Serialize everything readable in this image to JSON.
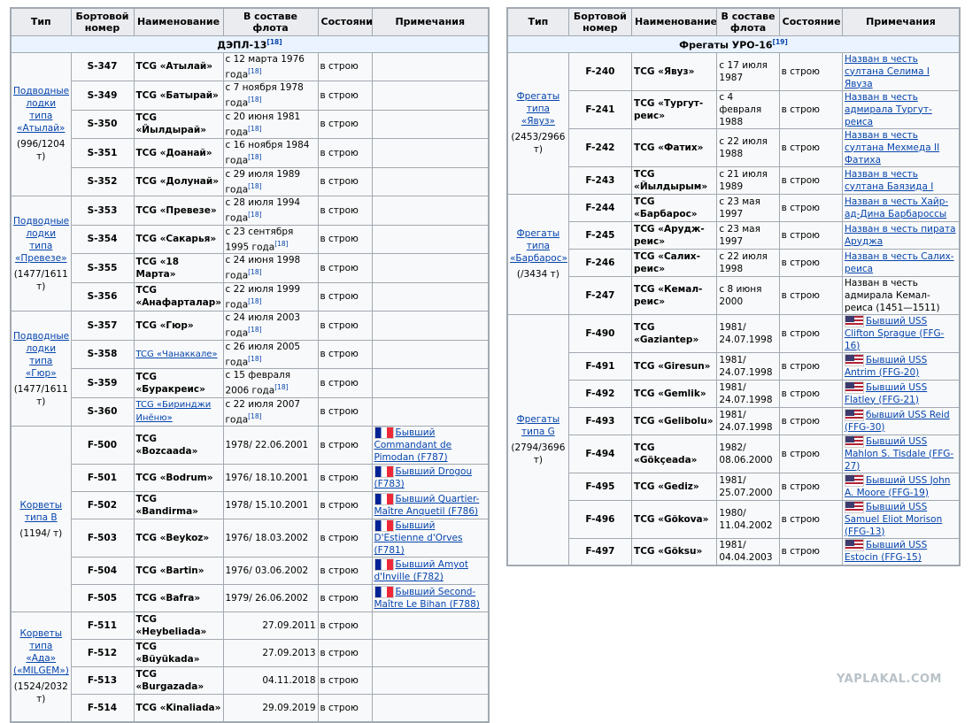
{
  "headers": [
    "Тип",
    "Бортовой номер",
    "Наименование",
    "В составе флота",
    "Состояние",
    "Примечания"
  ],
  "left": {
    "section": "ДЭПЛ-13",
    "section_ref": "[18]",
    "groups": [
      {
        "type_link": "Подводные лодки типа «Атылай»",
        "type_disp": "(996/1204 т)",
        "rows": [
          {
            "num": "S-347",
            "name": "TCG «Атылай»",
            "fleet": "с 12 марта 1976 года",
            "ref": "[18]",
            "state": "в строю",
            "note": ""
          },
          {
            "num": "S-349",
            "name": "TCG «Батырай»",
            "fleet": "с 7 ноября 1978 года",
            "ref": "[18]",
            "state": "в строю",
            "note": ""
          },
          {
            "num": "S-350",
            "name": "TCG «Йылдырай»",
            "fleet": "с 20 июня 1981 года",
            "ref": "[18]",
            "state": "в строю",
            "note": ""
          },
          {
            "num": "S-351",
            "name": "TCG «Доанай»",
            "fleet": "с 16 ноября 1984 года",
            "ref": "[18]",
            "state": "в строю",
            "note": ""
          },
          {
            "num": "S-352",
            "name": "TCG «Долунай»",
            "fleet": "с 29 июля 1989 года",
            "ref": "[18]",
            "state": "в строю",
            "note": ""
          }
        ]
      },
      {
        "type_link": "Подводные лодки типа «Превезе»",
        "type_disp": "(1477/1611 т)",
        "rows": [
          {
            "num": "S-353",
            "name": "TCG «Превезе»",
            "fleet": "с 28 июля 1994 года",
            "ref": "[18]",
            "state": "в строю",
            "note": ""
          },
          {
            "num": "S-354",
            "name": "TCG «Сакарья»",
            "fleet": "с 23 сентября 1995 года",
            "ref": "[18]",
            "state": "в строю",
            "note": ""
          },
          {
            "num": "S-355",
            "name": "TCG «18 Марта»",
            "fleet": "с 24 июня 1998 года",
            "ref": "[18]",
            "state": "в строю",
            "note": ""
          },
          {
            "num": "S-356",
            "name": "TCG «Анафарталар»",
            "fleet": "с 22 июля 1999 года",
            "ref": "[18]",
            "state": "в строю",
            "note": ""
          }
        ]
      },
      {
        "type_link": "Подводные лодки типа «Гюр»",
        "type_disp": "(1477/1611 т)",
        "rows": [
          {
            "num": "S-357",
            "name": "TCG «Гюр»",
            "fleet": "с 24 июля 2003 года",
            "ref": "[18]",
            "state": "в строю",
            "note": ""
          },
          {
            "num": "S-358",
            "name": "TCG «Чанаккале»",
            "fleet": "с 26 июля 2005 года",
            "ref": "[18]",
            "state": "в строю",
            "note": "",
            "link": true
          },
          {
            "num": "S-359",
            "name": "TCG «Буракреис»",
            "fleet": "с 15 февраля 2006 года",
            "ref": "[18]",
            "state": "в строю",
            "note": ""
          },
          {
            "num": "S-360",
            "name": "TCG «Биринджи Инёню»",
            "fleet": "с 22 июля 2007 года",
            "ref": "[18]",
            "state": "в строю",
            "note": "",
            "link": true
          }
        ]
      },
      {
        "type_link": "Корветы типа B",
        "type_disp": "(1194/ т)",
        "rows": [
          {
            "num": "F-500",
            "name": "TCG «Bozcaada»",
            "fleet": "1978/ 22.06.2001",
            "state": "в строю",
            "note": "Бывший Commandant de Pimodan (F787)",
            "flag": "fr"
          },
          {
            "num": "F-501",
            "name": "TCG «Bodrum»",
            "fleet": "1976/ 18.10.2001",
            "state": "в строю",
            "note": "Бывший Drogou (F783)",
            "flag": "fr"
          },
          {
            "num": "F-502",
            "name": "TCG «Bandirma»",
            "fleet": "1978/ 15.10.2001",
            "state": "в строю",
            "note": "Бывший Quartier-Maître Anquetil (F786)",
            "flag": "fr"
          },
          {
            "num": "F-503",
            "name": "TCG «Beykoz»",
            "fleet": "1976/ 18.03.2002",
            "state": "в строю",
            "note": "Бывший D'Estienne d'Orves (F781)",
            "flag": "fr"
          },
          {
            "num": "F-504",
            "name": "TCG «Bartin»",
            "fleet": "1976/ 03.06.2002",
            "state": "в строю",
            "note": "Бывший Amyot d'Inville (F782)",
            "flag": "fr"
          },
          {
            "num": "F-505",
            "name": "TCG «Bafra»",
            "fleet": "1979/ 26.06.2002",
            "state": "в строю",
            "note": "Бывший Second-Maître Le Bihan (F788)",
            "flag": "fr"
          }
        ]
      },
      {
        "type_link": "Корветы типа «Ада» («MILGEM»)",
        "type_disp": "(1524/2032 т)",
        "rows": [
          {
            "num": "F-511",
            "name": "TCG «Heybeliada»",
            "fleet": "27.09.2011",
            "state": "в строю",
            "note": "",
            "right": true
          },
          {
            "num": "F-512",
            "name": "TCG «Büyükada»",
            "fleet": "27.09.2013",
            "state": "в строю",
            "note": "",
            "right": true
          },
          {
            "num": "F-513",
            "name": "TCG «Burgazada»",
            "fleet": "04.11.2018",
            "state": "в строю",
            "note": "",
            "right": true
          },
          {
            "num": "F-514",
            "name": "TCG «Kinaliada»",
            "fleet": "29.09.2019",
            "state": "в строю",
            "note": "",
            "right": true
          }
        ]
      }
    ]
  },
  "right": {
    "section": "Фрегаты УРО-16",
    "section_ref": "[19]",
    "groups": [
      {
        "type_link": "Фрегаты типа «Явуз»",
        "type_disp": "(2453/2966 т)",
        "rows": [
          {
            "num": "F-240",
            "name": "TCG «Явуз»",
            "fleet": "с 17 июля 1987",
            "state": "в строю",
            "note": "Назван в честь султана Селима I Явуза"
          },
          {
            "num": "F-241",
            "name": "TCG «Тургут-реис»",
            "fleet": "с 4 февраля 1988",
            "state": "в строю",
            "note": "Назван в честь адмирала Тургут-реиса"
          },
          {
            "num": "F-242",
            "name": "TCG «Фатих»",
            "fleet": "с 22 июля 1988",
            "state": "в строю",
            "note": "Назван в честь султана Мехмеда II Фатиха"
          },
          {
            "num": "F-243",
            "name": "TCG «Йылдырым»",
            "fleet": "с 21 июля 1989",
            "state": "в строю",
            "note": "Назван в честь султана Баязида I"
          }
        ]
      },
      {
        "type_link": "Фрегаты типа «Барбарос»",
        "type_disp": "(/3434 т)",
        "rows": [
          {
            "num": "F-244",
            "name": "TCG «Барбарос»",
            "fleet": "с 23 мая 1997",
            "state": "в строю",
            "note": "Назван в честь Хайр-ад-Дина Барбароссы"
          },
          {
            "num": "F-245",
            "name": "TCG «Арудж-реис»",
            "fleet": "с 23 мая 1997",
            "state": "в строю",
            "note": "Назван в честь пирата Аруджа"
          },
          {
            "num": "F-246",
            "name": "TCG «Салих-реис»",
            "fleet": "с 22 июля 1998",
            "state": "в строю",
            "note": "Назван в честь Салих-реиса"
          },
          {
            "num": "F-247",
            "name": "TCG «Кемал-реис»",
            "fleet": "с 8 июня 2000",
            "state": "в строю",
            "note": "Назван в честь адмирала Кемал-реиса (1451—1511)",
            "plain": true
          }
        ]
      },
      {
        "type_link": "Фрегаты типа G",
        "type_disp": "(2794/3696 т)",
        "rows": [
          {
            "num": "F-490",
            "name": "TCG «Gaziantep»",
            "fleet": "1981/ 24.07.1998",
            "state": "в строю",
            "note": "Бывший USS Clifton Sprague (FFG-16)",
            "flag": "us"
          },
          {
            "num": "F-491",
            "name": "TCG «Giresun»",
            "fleet": "1981/ 24.07.1998",
            "state": "в строю",
            "note": "Бывший USS Antrim (FFG-20)",
            "flag": "us"
          },
          {
            "num": "F-492",
            "name": "TCG «Gemlik»",
            "fleet": "1981/ 24.07.1998",
            "state": "в строю",
            "note": "Бывший USS Flatley (FFG-21)",
            "flag": "us"
          },
          {
            "num": "F-493",
            "name": "TCG «Gelibolu»",
            "fleet": "1981/ 24.07.1998",
            "state": "в строю",
            "note": "бывший USS Reid (FFG-30)",
            "flag": "us"
          },
          {
            "num": "F-494",
            "name": "TCG «Gökçeada»",
            "fleet": "1982/ 08.06.2000",
            "state": "в строю",
            "note": "Бывший USS Mahlon S. Tisdale (FFG-27)",
            "flag": "us"
          },
          {
            "num": "F-495",
            "name": "TCG «Gediz»",
            "fleet": "1981/ 25.07.2000",
            "state": "в строю",
            "note": "Бывший USS John A. Moore (FFG-19)",
            "flag": "us"
          },
          {
            "num": "F-496",
            "name": "TCG «Gökova»",
            "fleet": "1980/ 11.04.2002",
            "state": "в строю",
            "note": "Бывший USS Samuel Eliot Morison (FFG-13)",
            "flag": "us"
          },
          {
            "num": "F-497",
            "name": "TCG «Göksu»",
            "fleet": "1981/ 04.04.2003",
            "state": "в строю",
            "note": "Бывший USS Estocin (FFG-15)",
            "flag": "us"
          }
        ]
      }
    ]
  },
  "watermark": "YAPLAKAL.COM"
}
